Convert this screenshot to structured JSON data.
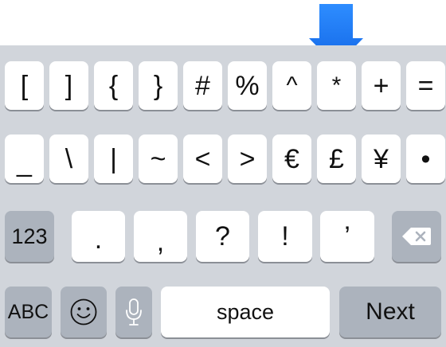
{
  "row1": [
    "[",
    "]",
    "{",
    "}",
    "#",
    "%",
    "^",
    "*",
    "+",
    "="
  ],
  "row2": [
    "_",
    "\\",
    "|",
    "~",
    "<",
    ">",
    "€",
    "£",
    "¥",
    "•"
  ],
  "row3": {
    "mode_label": "123",
    "punct": [
      ".",
      ",",
      "?",
      "!",
      "’"
    ]
  },
  "row4": {
    "abc_label": "ABC",
    "space_label": "space",
    "next_label": "Next"
  },
  "icons": {
    "pointer": "arrow-down-icon",
    "backspace": "backspace-icon",
    "emoji": "smiley-icon",
    "dictation": "microphone-icon"
  },
  "colors": {
    "keyboard_bg": "#d1d5db",
    "key_bg": "#ffffff",
    "function_key_bg": "#acb3bd",
    "pointer_arrow": "#1f7cf5"
  }
}
